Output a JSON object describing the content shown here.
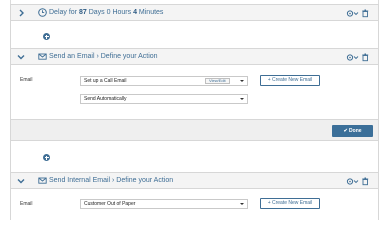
{
  "steps": [
    {
      "title_prefix": "Delay for ",
      "title_days": "87",
      "title_suffix": " Days 0 Hours ",
      "title_minutes": "4",
      "title_end": " Minutes"
    },
    {
      "title": "Send an Email  ›  Define your Action",
      "email_label": "Email",
      "email_value": "Set up a Call Email",
      "view_edit_label": "View/Edit",
      "send_option": "Send Automatically",
      "create_label": "+ Create New Email",
      "done_label": "✔ Done"
    },
    {
      "title": "Send Internal Email  ›  Define your Action",
      "email_label": "Email",
      "email_value": "Customer Out of Paper",
      "create_label": "+ Create New Email"
    }
  ],
  "icons": {
    "chevron": "chevron-down-icon",
    "clock": "clock-icon",
    "email": "envelope-icon",
    "tools": "gear-icon",
    "delete": "trash-icon",
    "add": "plus-circle-icon"
  },
  "colors": {
    "accent": "#3f6e95",
    "button": "#3b6f99",
    "header_bg": "#f4f4f4",
    "footer_bg": "#efefef"
  }
}
